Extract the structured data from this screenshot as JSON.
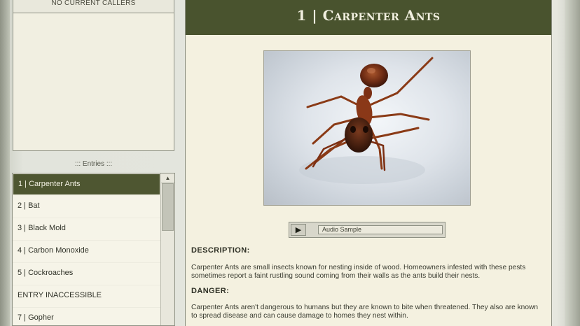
{
  "callers": {
    "header": "NO CURRENT CALLERS"
  },
  "entries": {
    "title": "::: Entries :::",
    "scroll_up_glyph": "▲",
    "items": [
      {
        "label": "1 | Carpenter Ants",
        "selected": true
      },
      {
        "label": "2 | Bat"
      },
      {
        "label": "3 | Black Mold"
      },
      {
        "label": "4 | Carbon Monoxide"
      },
      {
        "label": "5 | Cockroaches"
      },
      {
        "label": "ENTRY INACCESSIBLE"
      },
      {
        "label": "7 | Gopher"
      }
    ]
  },
  "article": {
    "title": "1 | Carpenter Ants",
    "image_alt": "Photo of a carpenter ant",
    "audio": {
      "play_glyph": "▶",
      "label": "Audio Sample"
    },
    "description_heading": "DESCRIPTION:",
    "description_text": "Carpenter Ants are small insects known for nesting inside of wood. Homeowners infested with these pests sometimes report a faint rustling sound coming from their walls as the ants build their nests.",
    "danger_heading": "DANGER:",
    "danger_text": "Carpenter Ants aren't dangerous to humans but they are known to bite when threatened. They also are known to spread disease and can cause damage to homes they nest within."
  },
  "colors": {
    "header_bg": "#49532e",
    "selected_bg": "#4e5631",
    "panel_bg": "#f4f1e0"
  }
}
